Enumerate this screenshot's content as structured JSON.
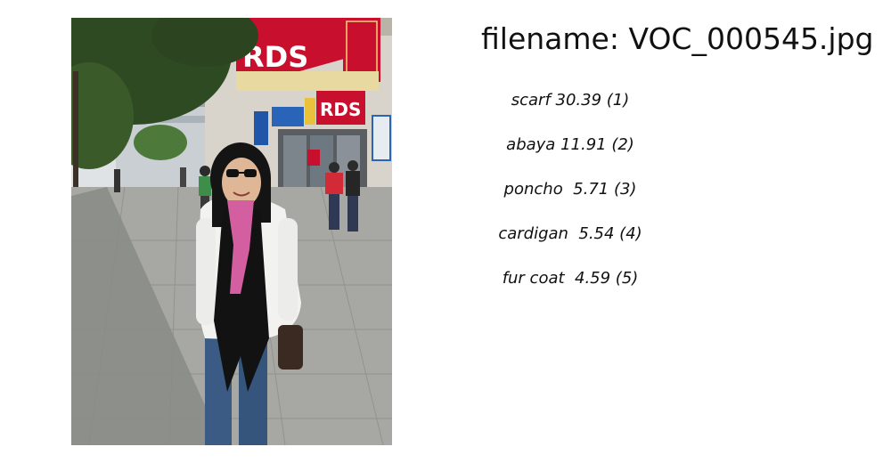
{
  "filename_label": "filename: VOC_000545.jpg",
  "predictions": [
    {
      "text": "scarf 30.39 (1)"
    },
    {
      "text": "abaya 11.91 (2)"
    },
    {
      "text": "poncho  5.71 (3)"
    },
    {
      "text": "cardigan  5.54 (4)"
    },
    {
      "text": "fur coat  4.59 (5)"
    }
  ],
  "colors": {
    "text": "#111111",
    "background": "#ffffff",
    "rds_sign_red": "#c8102e"
  }
}
